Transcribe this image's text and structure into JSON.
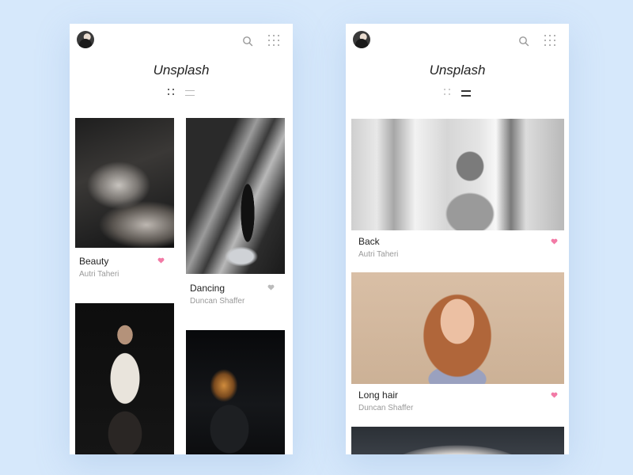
{
  "app": {
    "title": "Unsplash"
  },
  "colors": {
    "background": "#d6e8fb",
    "heart_active": "#f27aa6",
    "heart_inactive": "#bbbbbb"
  },
  "icons": {
    "search": "search-icon",
    "menu": "grid-dots-icon",
    "heart": "heart-icon"
  },
  "left_phone": {
    "view_mode": "grid",
    "cards": [
      {
        "name": "Beauty",
        "author": "Autri Taheri",
        "liked": true
      },
      {
        "name": "Dancing",
        "author": "Duncan Shaffer",
        "liked": false
      },
      {
        "name": "",
        "author": "",
        "liked": false
      },
      {
        "name": "",
        "author": "",
        "liked": false
      }
    ]
  },
  "right_phone": {
    "view_mode": "list",
    "cards": [
      {
        "name": "Back",
        "author": "Autri Taheri",
        "liked": true
      },
      {
        "name": "Long hair",
        "author": "Duncan Shaffer",
        "liked": true
      },
      {
        "name": "",
        "author": "",
        "liked": false
      }
    ]
  }
}
